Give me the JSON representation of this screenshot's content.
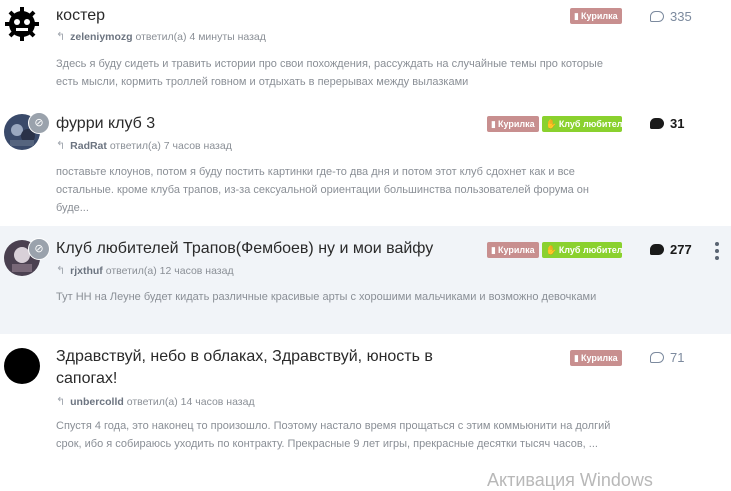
{
  "topics": [
    {
      "title": "костер",
      "user": "zeleniymozg",
      "action": "ответил(а)",
      "time": "4 минуты назад",
      "excerpt": "Здесь я буду сидеть и травить истории про свои похождения, рассуждать на случайные темы про которые есть мысли, кормить троллей говном и отдыхать в перерывах между вылазками",
      "tags": [
        "Курилка"
      ],
      "replies": "335"
    },
    {
      "title": "фурри клуб 3",
      "user": "RadRat",
      "action": "ответил(а)",
      "time": "7 часов назад",
      "excerpt": "поставьте клоунов, потом я буду постить картинки где-то два дня и потом этот клуб сдохнет как и все остальные. кроме клуба трапов, из-за сексуальной ориентации большинства пользователей форума он буде...",
      "tags": [
        "Курилка",
        "Клуб любителей"
      ],
      "replies": "31"
    },
    {
      "title": "Клуб любителей Трапов(Фембоев) ну и мои вайфу",
      "user": "rjxthuf",
      "action": "ответил(а)",
      "time": "12 часов назад",
      "excerpt": "Тут НН на Леуне будет кидать различные красивые арты с хорошими мальчиками и возможно девочками",
      "tags": [
        "Курилка",
        "Клуб любителей"
      ],
      "replies": "277"
    },
    {
      "title": "Здравствуй, небо в облаках, Здравствуй, юность в сапогах!",
      "user": "unbercolld",
      "action": "ответил(а)",
      "time": "14 часов назад",
      "excerpt": "Спустя 4 года, это наконец то произошло. Поэтому настало время прощаться с этим коммьюнити на долгий срок, ибо я собираюсь уходить по контракту. Прекрасные 9 лет игры, прекрасные десятки тысяч часов, ...",
      "tags": [
        "Курилка"
      ],
      "replies": "71"
    }
  ],
  "icons": {
    "reply": "reply-arrow-icon",
    "tag": "tag-icon",
    "club_tag": "hand-icon",
    "comments": "comment-bubble-icon",
    "menu": "more-vertical-icon"
  },
  "watermark": "Активация Windows",
  "colors": {
    "kurilka_tag": "#c88f8f",
    "club_tag": "#8ad12e",
    "highlight_row": "#f1f4f8"
  }
}
